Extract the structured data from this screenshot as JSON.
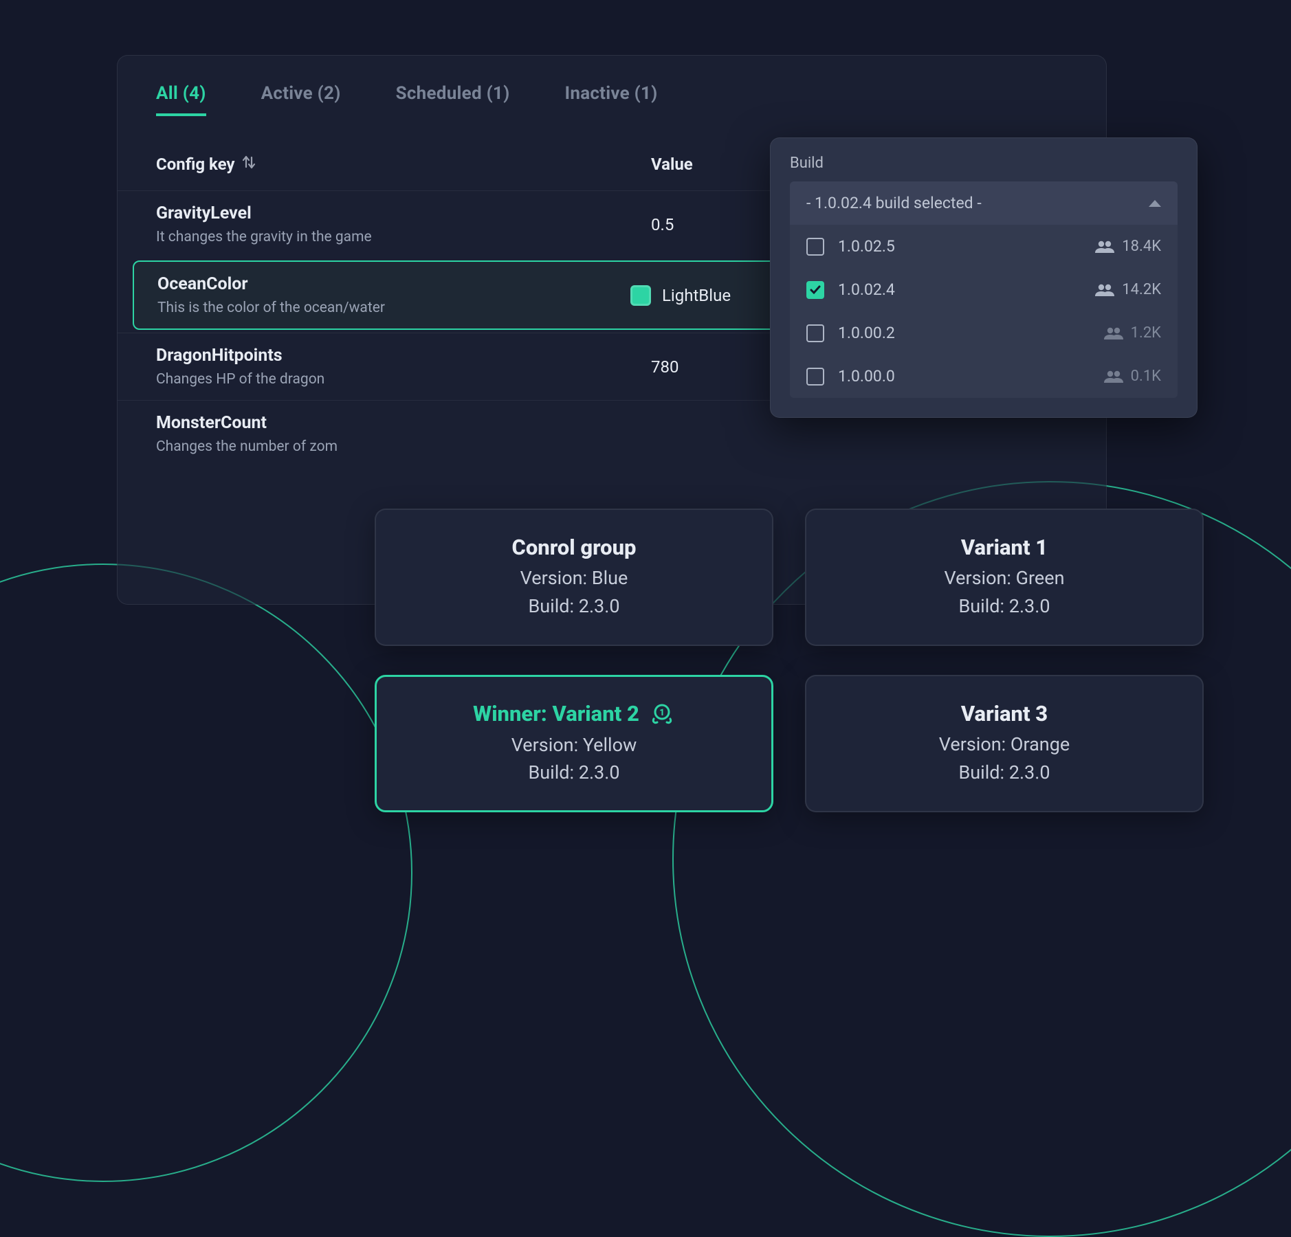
{
  "tabs": [
    {
      "label": "All (4)",
      "active": true
    },
    {
      "label": "Active (2)",
      "active": false
    },
    {
      "label": "Scheduled (1)",
      "active": false
    },
    {
      "label": "Inactive (1)",
      "active": false
    }
  ],
  "columns": {
    "key": "Config key",
    "value": "Value"
  },
  "rows": [
    {
      "key": "GravityLevel",
      "desc": "It changes the gravity in the game",
      "value": "0.5",
      "highlighted": false,
      "swatch": false
    },
    {
      "key": "OceanColor",
      "desc": "This is the color of the ocean/water",
      "value": "LightBlue",
      "highlighted": true,
      "swatch": true
    },
    {
      "key": "DragonHitpoints",
      "desc": "Changes HP of the dragon",
      "value": "780",
      "highlighted": false,
      "swatch": false
    },
    {
      "key": "MonsterCount",
      "desc": "Changes the number of zom",
      "value": "",
      "highlighted": false,
      "swatch": false
    }
  ],
  "build_popover": {
    "label": "Build",
    "selected_text": "- 1.0.02.4 build selected -",
    "options": [
      {
        "version": "1.0.02.5",
        "users": "18.4K",
        "checked": false,
        "dim": false
      },
      {
        "version": "1.0.02.4",
        "users": "14.2K",
        "checked": true,
        "dim": false
      },
      {
        "version": "1.0.00.2",
        "users": "1.2K",
        "checked": false,
        "dim": true
      },
      {
        "version": "1.0.00.0",
        "users": "0.1K",
        "checked": false,
        "dim": true
      }
    ]
  },
  "cards": [
    {
      "title": "Conrol group",
      "version": "Blue",
      "build": "2.3.0",
      "winner": false
    },
    {
      "title": "Variant 1",
      "version": "Green",
      "build": "2.3.0",
      "winner": false
    },
    {
      "title": "Winner: Variant 2",
      "version": "Yellow",
      "build": "2.3.0",
      "winner": true
    },
    {
      "title": "Variant 3",
      "version": "Orange",
      "build": "2.3.0",
      "winner": false
    }
  ],
  "labels": {
    "version_prefix": "Version: ",
    "build_prefix": "Build: "
  },
  "colors": {
    "accent": "#2dd4a4"
  }
}
